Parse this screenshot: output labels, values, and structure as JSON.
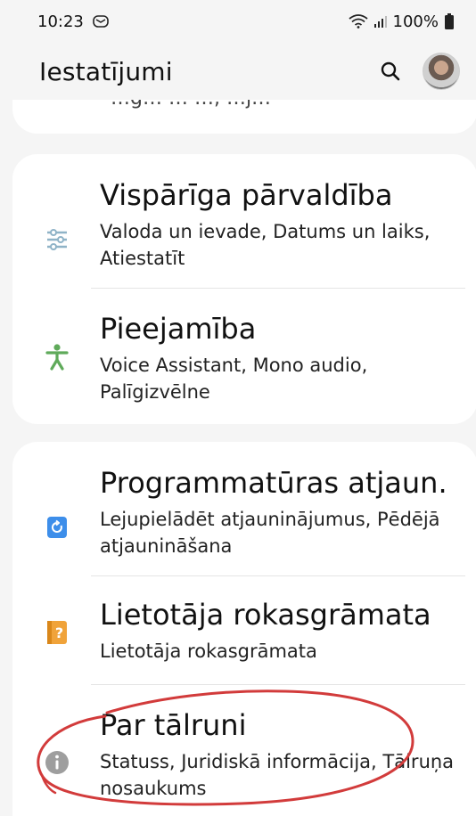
{
  "status_bar": {
    "time": "10:23",
    "battery": "100%",
    "icons": [
      "message-icon",
      "wifi-icon",
      "signal-icon",
      "battery-icon"
    ]
  },
  "header": {
    "title": "Iestatījumi",
    "search_icon": "search-icon",
    "avatar": "profile-avatar"
  },
  "partial_item": {
    "text": "…g… … …, …j…"
  },
  "groups": [
    {
      "items": [
        {
          "title": "Vispārīga pārvaldība",
          "subtitle": "Valoda un ievade, Datums un laiks, Atiestatīt",
          "icon": "sliders-icon",
          "icon_color": "#8fb3c7"
        },
        {
          "title": "Pieejamība",
          "subtitle": "Voice Assistant, Mono audio, Palīgizvēlne",
          "icon": "accessibility-icon",
          "icon_color": "#5faa5a"
        }
      ]
    },
    {
      "items": [
        {
          "title": "Programmatūras atjaun.",
          "subtitle": "Lejupielādēt atjauninājumus, Pēdējā atjaunināšana",
          "icon": "software-update-icon",
          "icon_color": "#3d8eea"
        },
        {
          "title": "Lietotāja rokasgrāmata",
          "subtitle": "Lietotāja rokasgrāmata",
          "icon": "user-manual-icon",
          "icon_color": "#f0a33a"
        },
        {
          "title": "Par tālruni",
          "subtitle": "Statuss, Juridiskā informācija, Tālruņa nosaukums",
          "icon": "info-icon",
          "icon_color": "#9e9e9e"
        }
      ]
    }
  ],
  "colors": {
    "background": "#f5f5f5",
    "card": "#ffffff",
    "annotation": "#d23b3b"
  }
}
